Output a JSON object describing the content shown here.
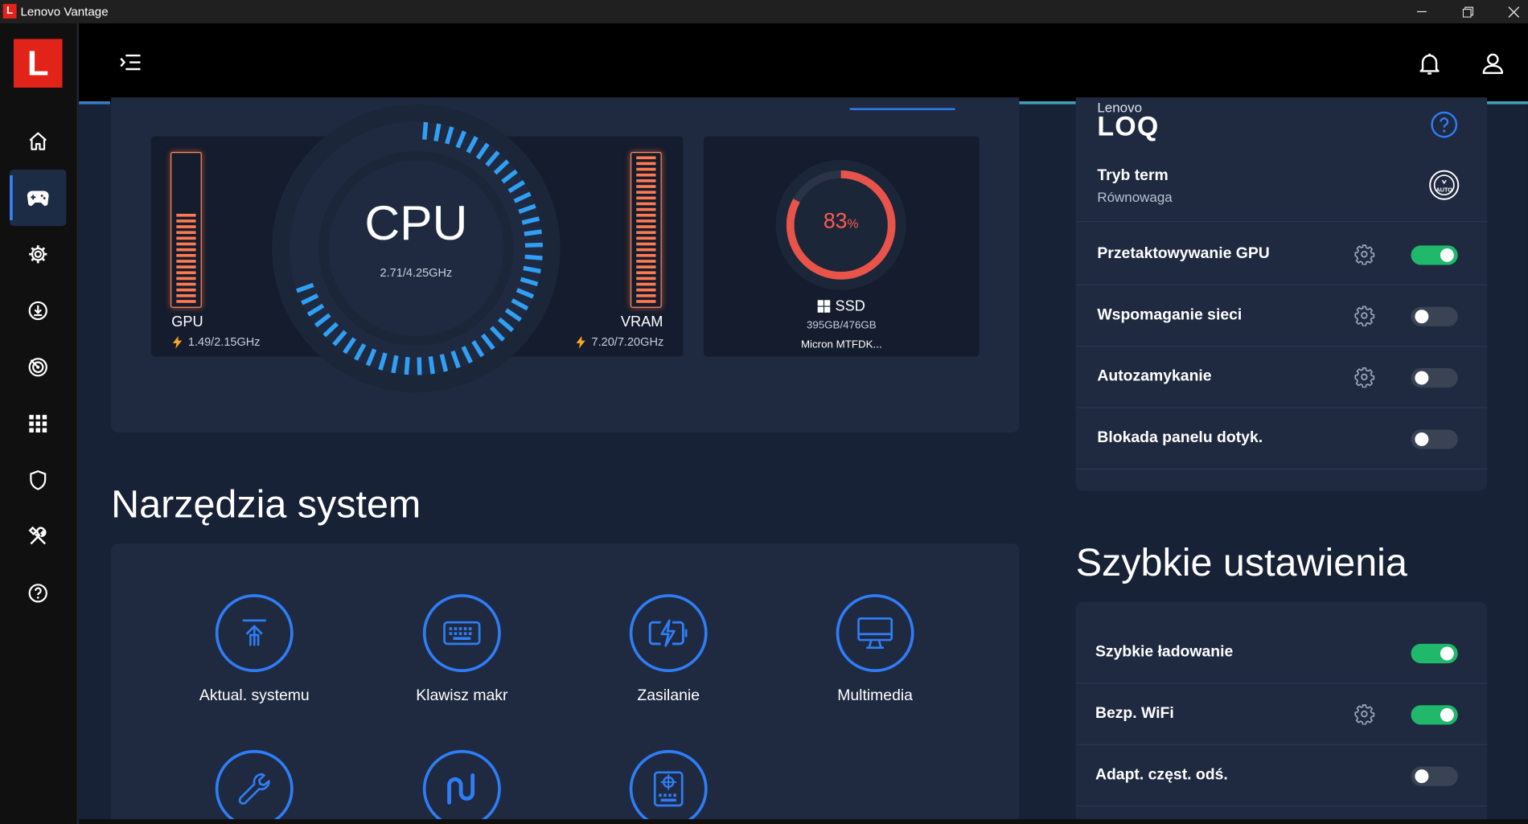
{
  "window": {
    "title": "Lenovo Vantage",
    "logo_letter": "L"
  },
  "sidebar": {
    "logo_letter": "L",
    "items": [
      {
        "icon": "home-icon"
      },
      {
        "icon": "gamepad-icon"
      },
      {
        "icon": "gear-icon"
      },
      {
        "icon": "download-icon"
      },
      {
        "icon": "radar-icon"
      },
      {
        "icon": "apps-grid-icon"
      },
      {
        "icon": "shield-icon"
      },
      {
        "icon": "tools-icon"
      },
      {
        "icon": "help-icon"
      }
    ]
  },
  "monitor": {
    "gpu": {
      "label": "GPU",
      "freq": "1.49/2.15GHz",
      "level": 0.62
    },
    "cpu": {
      "label": "CPU",
      "freq": "2.71/4.25GHz",
      "level": 0.64
    },
    "vram": {
      "label": "VRAM",
      "freq": "7.20/7.20GHz",
      "level": 1.0
    },
    "ssd": {
      "percent": "83",
      "percent_unit": "%",
      "label": "SSD",
      "usage": "395GB/476GB",
      "model": "Micron MTFDK...",
      "level": 0.83
    }
  },
  "tools": {
    "heading": "Narzędzia system",
    "items": [
      {
        "label": "Aktual. systemu",
        "icon": "system-update-icon"
      },
      {
        "label": "Klawisz makr",
        "icon": "keyboard-icon"
      },
      {
        "label": "Zasilanie",
        "icon": "battery-bolt-icon"
      },
      {
        "label": "Multimedia",
        "icon": "monitor-icon"
      },
      {
        "label": "",
        "icon": "wrench-icon"
      },
      {
        "label": "",
        "icon": "wave-icon"
      },
      {
        "label": "",
        "icon": "keyboard-target-icon"
      }
    ]
  },
  "game_panel": {
    "brand_small": "Lenovo",
    "brand_big": "LOQ",
    "thermal_title": "Tryb term",
    "thermal_value": "Równowaga",
    "rows": [
      {
        "label": "Przetaktowywanie GPU",
        "gear": true,
        "on": true
      },
      {
        "label": "Wspomaganie sieci",
        "gear": true,
        "on": false
      },
      {
        "label": "Autozamykanie",
        "gear": true,
        "on": false
      },
      {
        "label": "Blokada panelu dotyk.",
        "gear": false,
        "on": false
      }
    ]
  },
  "quick": {
    "heading": "Szybkie ustawienia",
    "rows": [
      {
        "label": "Szybkie ładowanie",
        "gear": false,
        "on": true
      },
      {
        "label": "Bezp. WiFi",
        "gear": true,
        "on": true
      },
      {
        "label": "Adapt. częst. odś.",
        "gear": false,
        "on": false
      }
    ]
  },
  "colors": {
    "accent": "#2f7df6",
    "toggle_on": "#20b86a",
    "bar": "#ff7a50",
    "ssd": "#e8534a"
  }
}
